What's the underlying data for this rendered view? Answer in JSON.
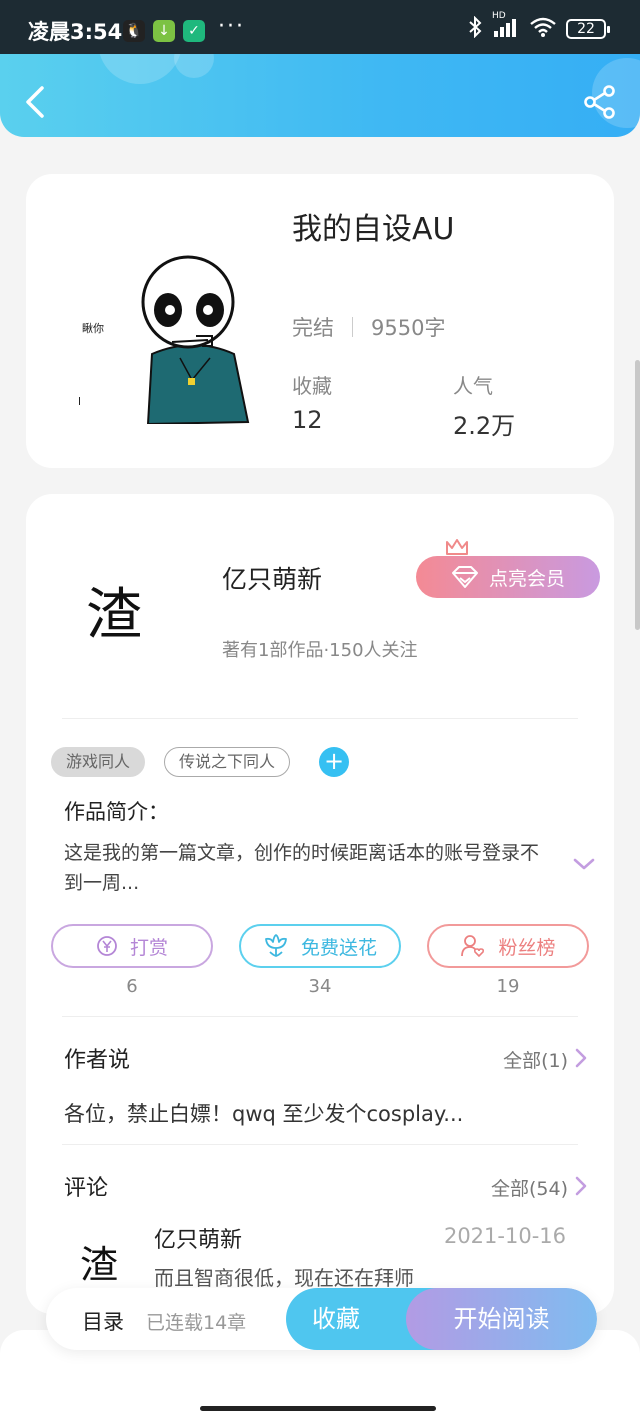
{
  "status_bar": {
    "time": "凌晨3:54",
    "network": "HD",
    "battery": "22",
    "more": "···"
  },
  "book": {
    "title": "我的自设AU",
    "status": "完结",
    "word_count": "9550字",
    "favorites_label": "收藏",
    "favorites_value": "12",
    "popularity_label": "人气",
    "popularity_value": "2.2万",
    "cover_text": "瞅你"
  },
  "author": {
    "avatar_char": "渣",
    "name": "亿只萌新",
    "meta": "著有1部作品·150人关注",
    "vip_label": "点亮会员"
  },
  "tags": [
    "游戏同人",
    "传说之下同人"
  ],
  "tag_add": "+",
  "intro": {
    "heading": "作品简介：",
    "text": "这是我的第一篇文章，创作的时候距离话本的账号登录不到一周..."
  },
  "actions": [
    {
      "label": "打赏",
      "count": "6"
    },
    {
      "label": "免费送花",
      "count": "34"
    },
    {
      "label": "粉丝榜",
      "count": "19"
    }
  ],
  "author_note": {
    "title": "作者说",
    "all_label": "全部(1)",
    "text": "各位，禁止白嫖！qwq 至少发个cosplay..."
  },
  "comments": {
    "title": "评论",
    "all_label": "全部(54)",
    "first": {
      "avatar_char": "渣",
      "name": "亿只萌新",
      "date": "2021-10-16",
      "text": "而且智商很低，现在还在拜师"
    }
  },
  "bottom_bar": {
    "toc_label": "目录",
    "toc_count": "已连载14章",
    "fav_label": "收藏",
    "read_label": "开始阅读"
  },
  "colors": {
    "header_start": "#5ad0ee",
    "header_end": "#35aef5",
    "accent_blue": "#4fc6ef",
    "vip_pink": "#f48a94",
    "vip_purple": "#c99ae0"
  }
}
